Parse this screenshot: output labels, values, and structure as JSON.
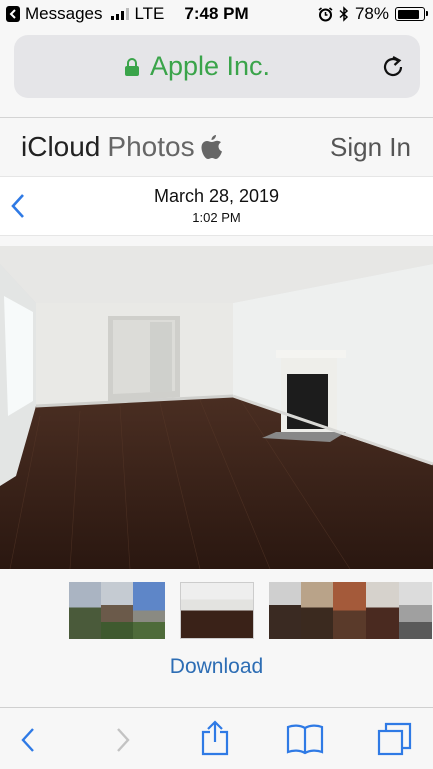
{
  "status_bar": {
    "back_app": "Messages",
    "carrier": "LTE",
    "time": "7:48 PM",
    "battery": "78%",
    "battery_level": 0.78
  },
  "address_bar": {
    "site_name": "Apple Inc."
  },
  "header": {
    "brand_primary": "iCloud",
    "brand_secondary": "Photos",
    "sign_in": "Sign In"
  },
  "photo": {
    "date": "March 28, 2019",
    "time": "1:02 PM"
  },
  "actions": {
    "download": "Download"
  },
  "colors": {
    "accent": "#2d6db4",
    "secure_green": "#3aa44a",
    "ios_blue": "#2f7ae5"
  },
  "icons": {
    "status": [
      "back-arrow-icon",
      "signal-icon",
      "alarm-icon",
      "bluetooth-icon",
      "battery-icon"
    ],
    "address": [
      "lock-icon",
      "reload-icon"
    ],
    "nav": [
      "back-chevron-icon"
    ],
    "toolbar": [
      "back-icon",
      "forward-icon",
      "share-icon",
      "bookmarks-icon",
      "tabs-icon"
    ]
  }
}
